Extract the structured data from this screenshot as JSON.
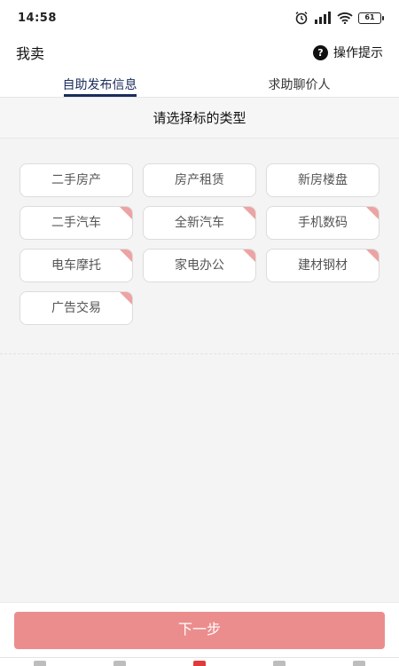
{
  "status_bar": {
    "time": "14:58",
    "battery": "61"
  },
  "header": {
    "title": "我卖",
    "help_label": "操作提示",
    "help_symbol": "?"
  },
  "tabs": [
    {
      "label": "自助发布信息",
      "active": true
    },
    {
      "label": "求助聊价人",
      "active": false
    }
  ],
  "section": {
    "title": "请选择标的类型"
  },
  "types": [
    {
      "label": "二手房产",
      "tagged": false
    },
    {
      "label": "房产租赁",
      "tagged": false
    },
    {
      "label": "新房楼盘",
      "tagged": false
    },
    {
      "label": "二手汽车",
      "tagged": true
    },
    {
      "label": "全新汽车",
      "tagged": true
    },
    {
      "label": "手机数码",
      "tagged": true
    },
    {
      "label": "电车摩托",
      "tagged": true
    },
    {
      "label": "家电办公",
      "tagged": true
    },
    {
      "label": "建材钢材",
      "tagged": true
    },
    {
      "label": "广告交易",
      "tagged": true
    }
  ],
  "footer": {
    "next_label": "下一步"
  },
  "bottom_nav": {
    "items": [
      "home-icon",
      "list-icon",
      "sell-icon",
      "message-icon",
      "profile-icon"
    ],
    "active_index": 2
  },
  "colors": {
    "accent": "#1a2b5c",
    "button": "#ec8d8d",
    "tag": "#eda3a3"
  }
}
